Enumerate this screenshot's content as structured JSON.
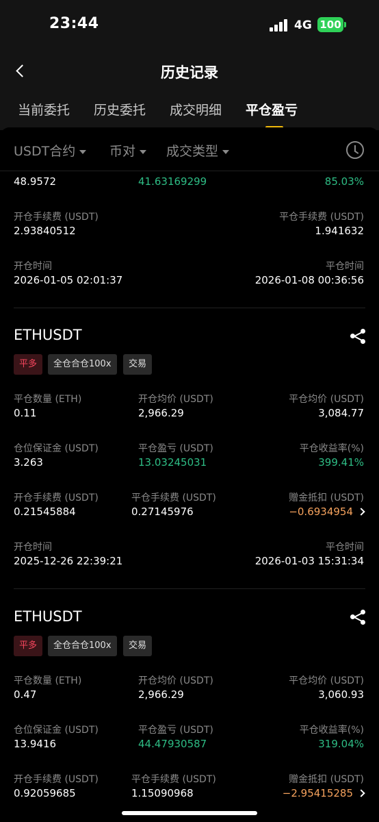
{
  "status": {
    "time": "23:44",
    "network": "4G",
    "battery": "100"
  },
  "nav": {
    "title": "历史记录"
  },
  "tabs": [
    {
      "label": "当前委托"
    },
    {
      "label": "历史委托"
    },
    {
      "label": "成交明细"
    },
    {
      "label": "平仓盈亏",
      "active": true
    }
  ],
  "filters": [
    {
      "label": "USDT合约"
    },
    {
      "label": "币对"
    },
    {
      "label": "成交类型"
    }
  ],
  "partial_record": {
    "values_top": [
      "48.9572",
      "41.63169299",
      "85.03%"
    ],
    "open_fee": {
      "label": "开仓手续费 (USDT)",
      "value": "2.93840512"
    },
    "close_fee": {
      "label": "平仓手续费 (USDT)",
      "value": "1.941632"
    },
    "open_time": {
      "label": "开仓时间",
      "value": "2026-01-05 02:01:37"
    },
    "close_time": {
      "label": "平仓时间",
      "value": "2026-01-08 00:36:56"
    }
  },
  "records": [
    {
      "symbol": "ETHUSDT",
      "tags": [
        "平多",
        "全仓合仓100x",
        "交易"
      ],
      "close_qty": {
        "label": "平仓数量 (ETH)",
        "value": "0.11"
      },
      "open_avg": {
        "label": "开仓均价 (USDT)",
        "value": "2,966.29"
      },
      "close_avg": {
        "label": "平仓均价 (USDT)",
        "value": "3,084.77"
      },
      "margin": {
        "label": "仓位保证金 (USDT)",
        "value": "3.263"
      },
      "pnl": {
        "label": "平仓盈亏 (USDT)",
        "value": "13.03245031"
      },
      "roi": {
        "label": "平仓收益率(%)",
        "value": "399.41%"
      },
      "open_fee": {
        "label": "开仓手续费 (USDT)",
        "value": "0.21545884"
      },
      "close_fee": {
        "label": "平仓手续费 (USDT)",
        "value": "0.27145976"
      },
      "bonus": {
        "label": "赠金抵扣 (USDT)",
        "value": "−0.6934954"
      },
      "open_time": {
        "label": "开仓时间",
        "value": "2025-12-26 22:39:21"
      },
      "close_time": {
        "label": "平仓时间",
        "value": "2026-01-03 15:31:34"
      }
    },
    {
      "symbol": "ETHUSDT",
      "tags": [
        "平多",
        "全仓合仓100x",
        "交易"
      ],
      "close_qty": {
        "label": "平仓数量 (ETH)",
        "value": "0.47"
      },
      "open_avg": {
        "label": "开仓均价 (USDT)",
        "value": "2,966.29"
      },
      "close_avg": {
        "label": "平仓均价 (USDT)",
        "value": "3,060.93"
      },
      "margin": {
        "label": "仓位保证金 (USDT)",
        "value": "13.9416"
      },
      "pnl": {
        "label": "平仓盈亏 (USDT)",
        "value": "44.47930587"
      },
      "roi": {
        "label": "平仓收益率(%)",
        "value": "319.04%"
      },
      "open_fee": {
        "label": "开仓手续费 (USDT)",
        "value": "0.92059685"
      },
      "close_fee": {
        "label": "平仓手续费 (USDT)",
        "value": "1.15090968"
      },
      "bonus": {
        "label": "赠金抵扣 (USDT)",
        "value": "−2.95415285"
      }
    }
  ],
  "colors": {
    "profit": "#2ebd85",
    "loss_tag": "#f6465d",
    "accent": "#f0b90b",
    "bonus": "#f5a25d"
  }
}
